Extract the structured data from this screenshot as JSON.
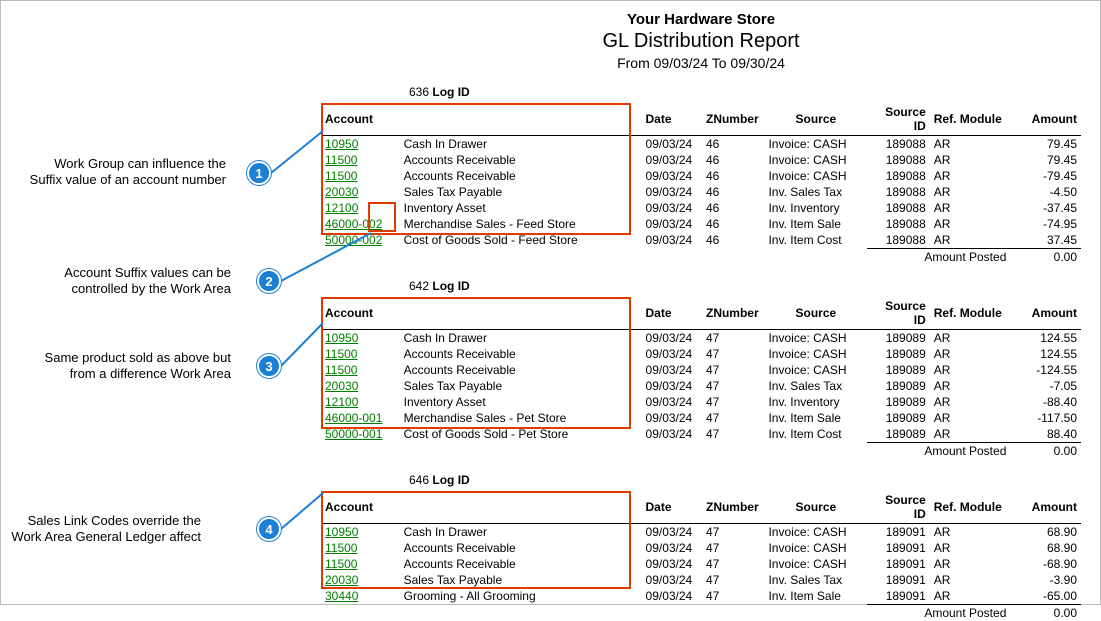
{
  "report": {
    "company": "Your Hardware Store",
    "title": "GL Distribution Report",
    "range": "From 09/03/24 To 09/30/24"
  },
  "headers": {
    "account": "Account",
    "date": "Date",
    "znumber": "ZNumber",
    "source": "Source",
    "source_id": "Source ID",
    "ref_module": "Ref. Module",
    "amount": "Amount"
  },
  "logid_label": "Log ID",
  "amount_posted_label": "Amount Posted",
  "sections": [
    {
      "log_id": "636",
      "amount_posted": "0.00",
      "rows": [
        {
          "account": "10950",
          "desc": "Cash In Drawer",
          "date": "09/03/24",
          "z": "46",
          "source": "Invoice: CASH",
          "sid": "189088",
          "ref": "AR",
          "amt": "79.45"
        },
        {
          "account": "11500",
          "desc": "Accounts Receivable",
          "date": "09/03/24",
          "z": "46",
          "source": "Invoice: CASH",
          "sid": "189088",
          "ref": "AR",
          "amt": "79.45"
        },
        {
          "account": "11500",
          "desc": "Accounts Receivable",
          "date": "09/03/24",
          "z": "46",
          "source": "Invoice: CASH",
          "sid": "189088",
          "ref": "AR",
          "amt": "-79.45"
        },
        {
          "account": "20030",
          "desc": "Sales Tax Payable",
          "date": "09/03/24",
          "z": "46",
          "source": "Inv. Sales Tax",
          "sid": "189088",
          "ref": "AR",
          "amt": "-4.50"
        },
        {
          "account": "12100",
          "desc": "Inventory Asset",
          "date": "09/03/24",
          "z": "46",
          "source": "Inv. Inventory",
          "sid": "189088",
          "ref": "AR",
          "amt": "-37.45"
        },
        {
          "account": "46000-002",
          "desc": "Merchandise Sales - Feed Store",
          "date": "09/03/24",
          "z": "46",
          "source": "Inv. Item Sale",
          "sid": "189088",
          "ref": "AR",
          "amt": "-74.95"
        },
        {
          "account": "50000-002",
          "desc": "Cost of Goods Sold - Feed Store",
          "date": "09/03/24",
          "z": "46",
          "source": "Inv. Item Cost",
          "sid": "189088",
          "ref": "AR",
          "amt": "37.45"
        }
      ]
    },
    {
      "log_id": "642",
      "amount_posted": "0.00",
      "rows": [
        {
          "account": "10950",
          "desc": "Cash In Drawer",
          "date": "09/03/24",
          "z": "47",
          "source": "Invoice: CASH",
          "sid": "189089",
          "ref": "AR",
          "amt": "124.55"
        },
        {
          "account": "11500",
          "desc": "Accounts Receivable",
          "date": "09/03/24",
          "z": "47",
          "source": "Invoice: CASH",
          "sid": "189089",
          "ref": "AR",
          "amt": "124.55"
        },
        {
          "account": "11500",
          "desc": "Accounts Receivable",
          "date": "09/03/24",
          "z": "47",
          "source": "Invoice: CASH",
          "sid": "189089",
          "ref": "AR",
          "amt": "-124.55"
        },
        {
          "account": "20030",
          "desc": "Sales Tax Payable",
          "date": "09/03/24",
          "z": "47",
          "source": "Inv. Sales Tax",
          "sid": "189089",
          "ref": "AR",
          "amt": "-7.05"
        },
        {
          "account": "12100",
          "desc": "Inventory Asset",
          "date": "09/03/24",
          "z": "47",
          "source": "Inv. Inventory",
          "sid": "189089",
          "ref": "AR",
          "amt": "-88.40"
        },
        {
          "account": "46000-001",
          "desc": "Merchandise Sales - Pet Store",
          "date": "09/03/24",
          "z": "47",
          "source": "Inv. Item Sale",
          "sid": "189089",
          "ref": "AR",
          "amt": "-117.50"
        },
        {
          "account": "50000-001",
          "desc": "Cost of Goods Sold - Pet Store",
          "date": "09/03/24",
          "z": "47",
          "source": "Inv. Item Cost",
          "sid": "189089",
          "ref": "AR",
          "amt": "88.40"
        }
      ]
    },
    {
      "log_id": "646",
      "amount_posted": "0.00",
      "rows": [
        {
          "account": "10950",
          "desc": "Cash In Drawer",
          "date": "09/03/24",
          "z": "47",
          "source": "Invoice: CASH",
          "sid": "189091",
          "ref": "AR",
          "amt": "68.90"
        },
        {
          "account": "11500",
          "desc": "Accounts Receivable",
          "date": "09/03/24",
          "z": "47",
          "source": "Invoice: CASH",
          "sid": "189091",
          "ref": "AR",
          "amt": "68.90"
        },
        {
          "account": "11500",
          "desc": "Accounts Receivable",
          "date": "09/03/24",
          "z": "47",
          "source": "Invoice: CASH",
          "sid": "189091",
          "ref": "AR",
          "amt": "-68.90"
        },
        {
          "account": "20030",
          "desc": "Sales Tax Payable",
          "date": "09/03/24",
          "z": "47",
          "source": "Inv. Sales Tax",
          "sid": "189091",
          "ref": "AR",
          "amt": "-3.90"
        },
        {
          "account": "30440",
          "desc": "Grooming - All Grooming",
          "date": "09/03/24",
          "z": "47",
          "source": "Inv. Item Sale",
          "sid": "189091",
          "ref": "AR",
          "amt": "-65.00"
        }
      ]
    }
  ],
  "callouts": {
    "c1": {
      "num": "1",
      "text": "Work Group can influence the Suffix value of an account number"
    },
    "c2": {
      "num": "2",
      "text": "Account Suffix values can be controlled by the Work Area"
    },
    "c3": {
      "num": "3",
      "text": "Same product sold as above but from a difference Work Area"
    },
    "c4": {
      "num": "4",
      "text": "Sales Link Codes override the Work Area General Ledger affect"
    }
  },
  "suffix_highlight_accounts": [
    "46000-002",
    "50000-002"
  ]
}
